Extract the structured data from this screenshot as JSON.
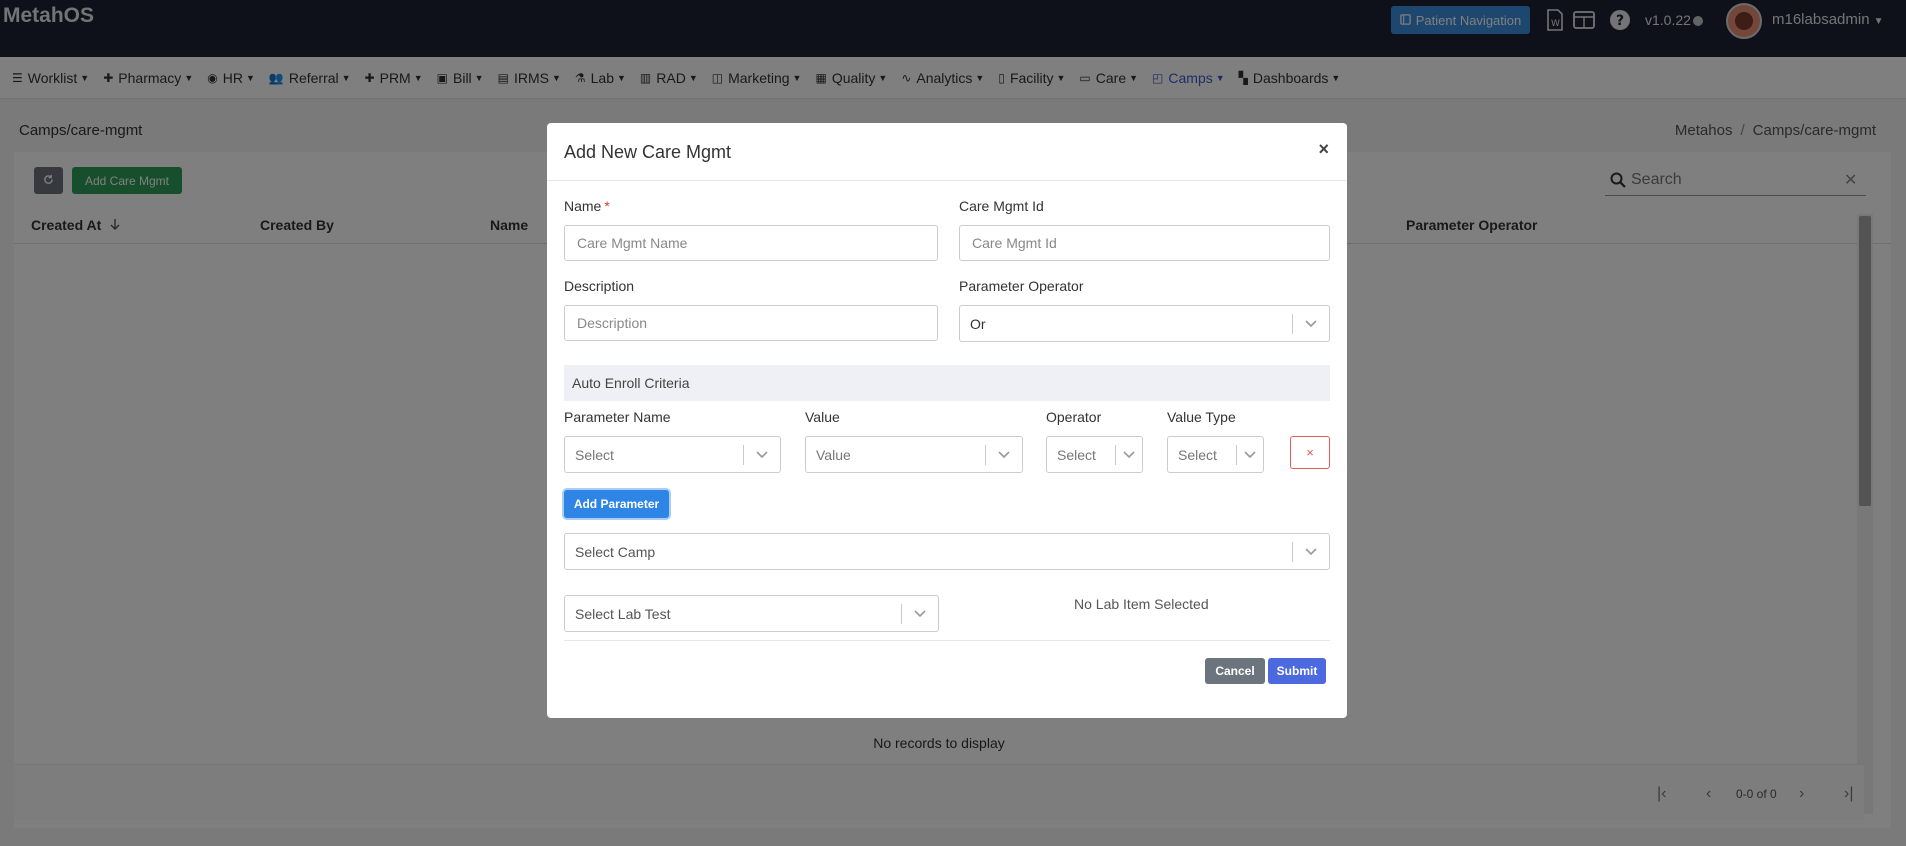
{
  "header": {
    "brand": "MetahOS",
    "patient_nav_label": "Patient Navigation",
    "version": "v1.0.22",
    "username": "m16labsadmin"
  },
  "nav": {
    "items": [
      {
        "label": "Worklist",
        "icon": "list-icon"
      },
      {
        "label": "Pharmacy",
        "icon": "plus-icon"
      },
      {
        "label": "HR",
        "icon": "user-circle-icon"
      },
      {
        "label": "Referral",
        "icon": "users-icon"
      },
      {
        "label": "PRM",
        "icon": "plus-icon"
      },
      {
        "label": "Bill",
        "icon": "bill-icon"
      },
      {
        "label": "IRMS",
        "icon": "card-icon"
      },
      {
        "label": "Lab",
        "icon": "flask-icon"
      },
      {
        "label": "RAD",
        "icon": "rad-icon"
      },
      {
        "label": "Marketing",
        "icon": "bag-icon"
      },
      {
        "label": "Quality",
        "icon": "quality-icon"
      },
      {
        "label": "Analytics",
        "icon": "pulse-icon"
      },
      {
        "label": "Facility",
        "icon": "building-icon"
      },
      {
        "label": "Care",
        "icon": "bed-icon"
      },
      {
        "label": "Camps",
        "icon": "briefcase-icon",
        "active": true
      },
      {
        "label": "Dashboards",
        "icon": "grid-icon"
      }
    ]
  },
  "page": {
    "breadcrumb_left": "Camps/care-mgmt",
    "breadcrumb_root": "Metahos",
    "breadcrumb_current": "Camps/care-mgmt",
    "add_button": "Add Care Mgmt",
    "search_placeholder": "Search",
    "columns": [
      "Created At",
      "Created By",
      "Name",
      "Parameter Operator"
    ],
    "no_records": "No records to display",
    "pagination_text": "0-0 of 0"
  },
  "modal": {
    "title": "Add New Care Mgmt",
    "name_label": "Name",
    "name_required": "*",
    "name_placeholder": "Care Mgmt Name",
    "id_label": "Care Mgmt Id",
    "id_placeholder": "Care Mgmt Id",
    "desc_label": "Description",
    "desc_placeholder": "Description",
    "param_op_label": "Parameter Operator",
    "param_op_value": "Or",
    "section_title": "Auto Enroll Criteria",
    "param_name_label": "Parameter Name",
    "param_name_placeholder": "Select",
    "value_label": "Value",
    "value_placeholder": "Value",
    "operator_label": "Operator",
    "operator_placeholder": "Select",
    "value_type_label": "Value Type",
    "value_type_placeholder": "Select",
    "delete_label": "×",
    "add_param_label": "Add Parameter",
    "camp_placeholder": "Select Camp",
    "lab_placeholder": "Select Lab Test",
    "no_lab_text": "No Lab Item Selected",
    "cancel_label": "Cancel",
    "submit_label": "Submit"
  }
}
